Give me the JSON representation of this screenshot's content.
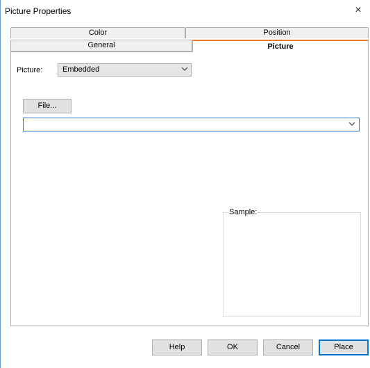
{
  "window": {
    "title": "Picture Properties",
    "close_glyph": "×"
  },
  "tabs": {
    "row1": [
      {
        "label": "Color"
      },
      {
        "label": "Position"
      }
    ],
    "row2": [
      {
        "label": "General"
      },
      {
        "label": "Picture",
        "active": true
      }
    ],
    "active_accent_color": "#e87a2c"
  },
  "picture": {
    "label": "Picture:",
    "source_value": "Embedded",
    "file_button": "File...",
    "file_value": ""
  },
  "sample": {
    "label": "Sample:"
  },
  "buttons": {
    "help": "Help",
    "ok": "OK",
    "cancel": "Cancel",
    "place": "Place",
    "default_button_border": "#0078d7"
  },
  "icons": {
    "dropdown": "chevron-down-icon",
    "close": "close-icon"
  }
}
